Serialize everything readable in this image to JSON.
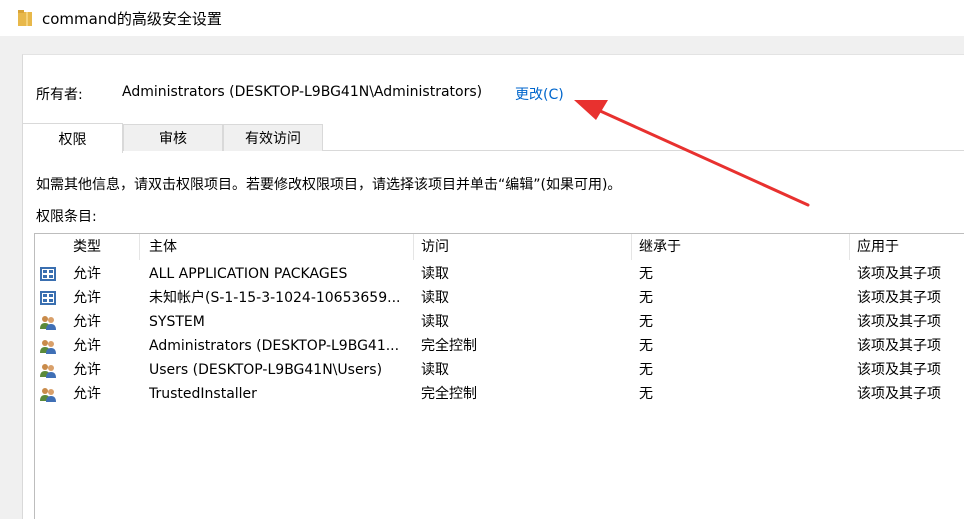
{
  "window": {
    "title": "command的高级安全设置",
    "icon": "folder-icon"
  },
  "owner": {
    "label": "所有者:",
    "value": "Administrators (DESKTOP-L9BG41N\\Administrators)",
    "change_link": "更改(C)"
  },
  "tabs": [
    {
      "label": "权限",
      "active": true
    },
    {
      "label": "审核",
      "active": false
    },
    {
      "label": "有效访问",
      "active": false
    }
  ],
  "info_text": "如需其他信息，请双击权限项目。若要修改权限项目，请选择该项目并单击“编辑”(如果可用)。",
  "entries_label": "权限条目:",
  "table": {
    "columns": [
      "类型",
      "主体",
      "访问",
      "继承于",
      "应用于"
    ],
    "rows": [
      {
        "icon": "app-package-icon",
        "type": "允许",
        "principal": "ALL APPLICATION PACKAGES",
        "access": "读取",
        "inherited": "无",
        "applies": "该项及其子项"
      },
      {
        "icon": "app-package-icon",
        "type": "允许",
        "principal": "未知帐户(S-1-15-3-1024-10653659...",
        "access": "读取",
        "inherited": "无",
        "applies": "该项及其子项"
      },
      {
        "icon": "user-group-icon",
        "type": "允许",
        "principal": "SYSTEM",
        "access": "读取",
        "inherited": "无",
        "applies": "该项及其子项"
      },
      {
        "icon": "user-group-icon",
        "type": "允许",
        "principal": "Administrators (DESKTOP-L9BG41...",
        "access": "完全控制",
        "inherited": "无",
        "applies": "该项及其子项"
      },
      {
        "icon": "user-group-icon",
        "type": "允许",
        "principal": "Users (DESKTOP-L9BG41N\\Users)",
        "access": "读取",
        "inherited": "无",
        "applies": "该项及其子项"
      },
      {
        "icon": "user-group-icon",
        "type": "允许",
        "principal": "TrustedInstaller",
        "access": "完全控制",
        "inherited": "无",
        "applies": "该项及其子项"
      }
    ]
  },
  "annotation": {
    "icon": "red-arrow-icon",
    "color": "#e8312f"
  },
  "colors": {
    "link": "#0066cc",
    "folder": "#e8b84a"
  }
}
